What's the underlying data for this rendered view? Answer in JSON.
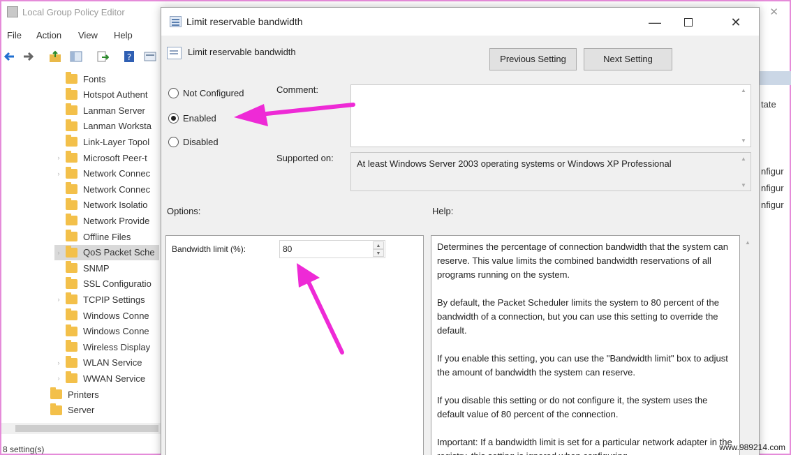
{
  "background_window": {
    "title": "Local Group Policy Editor",
    "close_glyph": "✕",
    "menu": [
      "File",
      "Action",
      "View",
      "Help"
    ],
    "tree": [
      {
        "label": "Fonts",
        "expandable": false,
        "selected": false
      },
      {
        "label": "Hotspot Authent",
        "expandable": false,
        "selected": false
      },
      {
        "label": "Lanman Server",
        "expandable": false,
        "selected": false
      },
      {
        "label": "Lanman Worksta",
        "expandable": false,
        "selected": false
      },
      {
        "label": "Link-Layer Topol",
        "expandable": false,
        "selected": false
      },
      {
        "label": "Microsoft Peer-t",
        "expandable": true,
        "selected": false
      },
      {
        "label": "Network Connec",
        "expandable": true,
        "selected": false
      },
      {
        "label": "Network Connec",
        "expandable": false,
        "selected": false
      },
      {
        "label": "Network Isolatio",
        "expandable": false,
        "selected": false
      },
      {
        "label": "Network Provide",
        "expandable": false,
        "selected": false
      },
      {
        "label": "Offline Files",
        "expandable": false,
        "selected": false
      },
      {
        "label": "QoS Packet Sche",
        "expandable": true,
        "selected": true
      },
      {
        "label": "SNMP",
        "expandable": false,
        "selected": false
      },
      {
        "label": "SSL Configuratio",
        "expandable": false,
        "selected": false
      },
      {
        "label": "TCPIP Settings",
        "expandable": true,
        "selected": false
      },
      {
        "label": "Windows Conne",
        "expandable": false,
        "selected": false
      },
      {
        "label": "Windows Conne",
        "expandable": false,
        "selected": false
      },
      {
        "label": "Wireless Display",
        "expandable": false,
        "selected": false
      },
      {
        "label": "WLAN Service",
        "expandable": true,
        "selected": false
      },
      {
        "label": "WWAN Service",
        "expandable": true,
        "selected": false
      },
      {
        "label": "Printers",
        "expandable": false,
        "selected": false,
        "level": 0
      },
      {
        "label": "Server",
        "expandable": false,
        "selected": false,
        "level": 0
      }
    ],
    "status": "8 setting(s)",
    "right_pane": {
      "header": "tate",
      "items": [
        "nfigur",
        "nfigur",
        "nfigur"
      ]
    }
  },
  "dialog": {
    "title": "Limit reservable bandwidth",
    "policy_name": "Limit reservable bandwidth",
    "buttons": {
      "previous": "Previous Setting",
      "next": "Next Setting"
    },
    "window_controls": {
      "minimize": "—",
      "close": "✕"
    },
    "radio_options": [
      {
        "label": "Not Configured",
        "checked": false
      },
      {
        "label": "Enabled",
        "checked": true
      },
      {
        "label": "Disabled",
        "checked": false
      }
    ],
    "comment": {
      "label": "Comment:",
      "value": ""
    },
    "supported_on": {
      "label": "Supported on:",
      "value": "At least Windows Server 2003 operating systems or Windows XP Professional"
    },
    "options_label": "Options:",
    "help_label": "Help:",
    "bandwidth": {
      "label": "Bandwidth limit (%):",
      "value": "80"
    },
    "help_paragraphs": [
      "Determines the percentage of connection bandwidth that the system can reserve. This value limits the combined bandwidth reservations of all programs running on the system.",
      "By default, the Packet Scheduler limits the system to 80 percent of the bandwidth of a connection, but you can use this setting to override the default.",
      "If you enable this setting, you can use the \"Bandwidth limit\" box to adjust the amount of bandwidth the system can reserve.",
      "If you disable this setting or do not configure it, the system uses the default value of 80 percent of the connection.",
      "Important: If a bandwidth limit is set for a particular network adapter in the registry, this setting is ignored when configuring"
    ]
  },
  "annotations": {
    "arrow_color": "#ee2ad6"
  },
  "watermark": "www.989214.com"
}
